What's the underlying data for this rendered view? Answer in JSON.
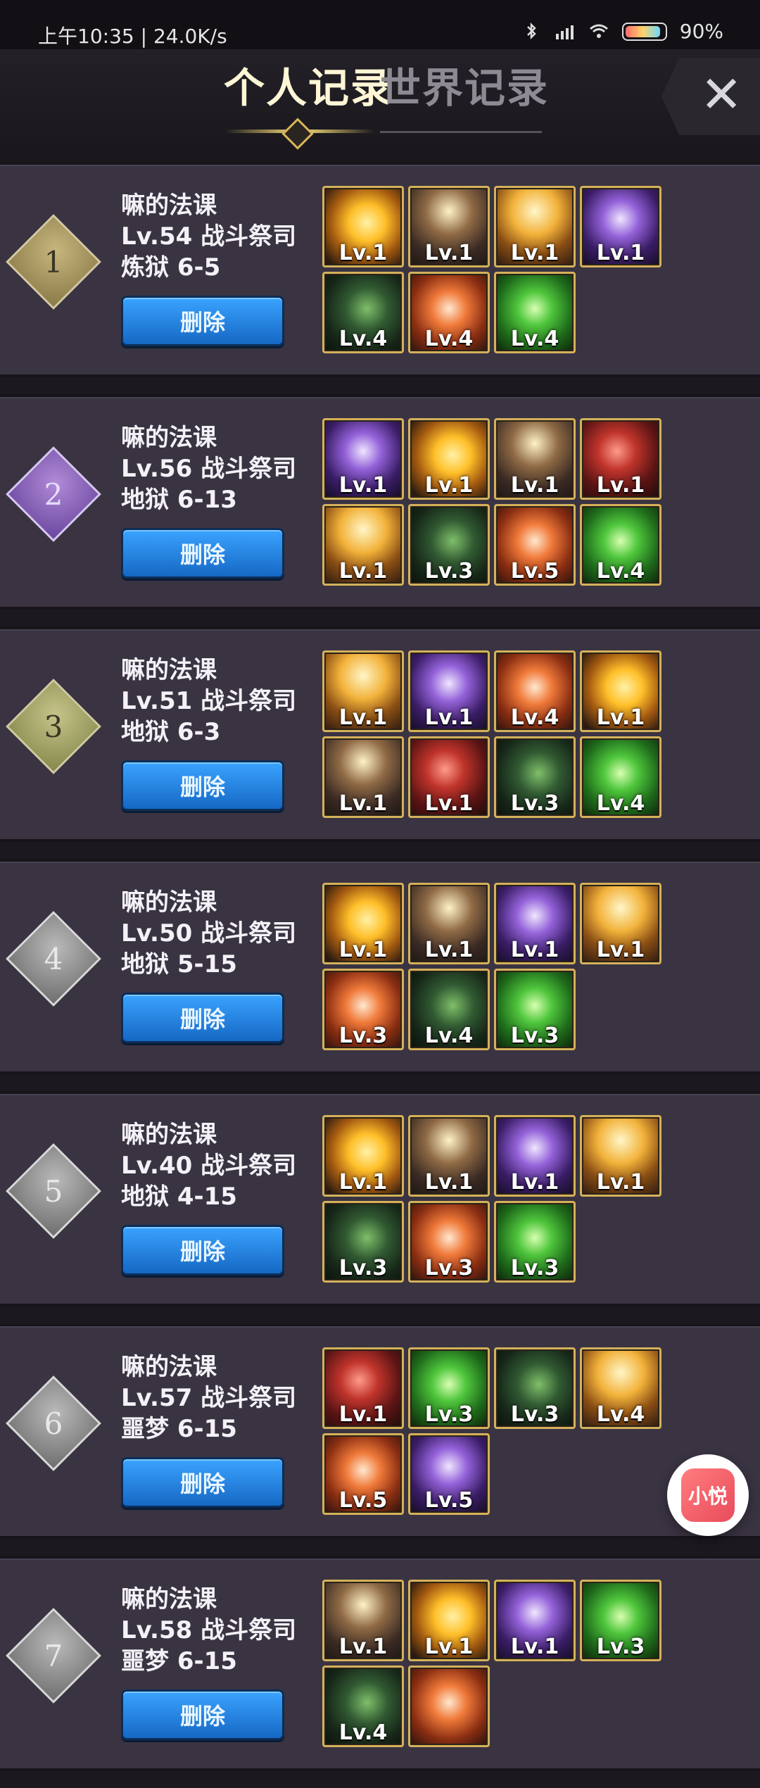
{
  "status": {
    "time": "上午10:35",
    "net_speed": "24.0K/s",
    "battery": "90%",
    "battery_fraction": 0.9
  },
  "header": {
    "tab_personal": "个人记录",
    "tab_world": "世界记录",
    "close_symbol": "✕"
  },
  "records": [
    {
      "rank": "1",
      "rank_style": "r1",
      "name": "嘛的法课",
      "level_class": "Lv.54 战斗祭司",
      "stage": "炼狱 6-5",
      "delete_label": "删除",
      "skills": [
        {
          "tile": "sun",
          "label": "Lv.1"
        },
        {
          "tile": "bow",
          "label": "Lv.1"
        },
        {
          "tile": "angel",
          "label": "Lv.1"
        },
        {
          "tile": "purple",
          "label": "Lv.1"
        },
        {
          "tile": "vines",
          "label": "Lv.4"
        },
        {
          "tile": "shield",
          "label": "Lv.4"
        },
        {
          "tile": "green",
          "label": "Lv.4"
        }
      ]
    },
    {
      "rank": "2",
      "rank_style": "r2",
      "name": "嘛的法课",
      "level_class": "Lv.56 战斗祭司",
      "stage": "地狱 6-13",
      "delete_label": "删除",
      "skills": [
        {
          "tile": "purple",
          "label": "Lv.1"
        },
        {
          "tile": "sun",
          "label": "Lv.1"
        },
        {
          "tile": "bow",
          "label": "Lv.1"
        },
        {
          "tile": "red",
          "label": "Lv.1"
        },
        {
          "tile": "angel",
          "label": "Lv.1"
        },
        {
          "tile": "vines",
          "label": "Lv.3"
        },
        {
          "tile": "shield",
          "label": "Lv.5"
        },
        {
          "tile": "green",
          "label": "Lv.4"
        }
      ]
    },
    {
      "rank": "3",
      "rank_style": "r3",
      "name": "嘛的法课",
      "level_class": "Lv.51 战斗祭司",
      "stage": "地狱 6-3",
      "delete_label": "删除",
      "skills": [
        {
          "tile": "angel",
          "label": "Lv.1"
        },
        {
          "tile": "purple",
          "label": "Lv.1"
        },
        {
          "tile": "shield",
          "label": "Lv.4"
        },
        {
          "tile": "sun",
          "label": "Lv.1"
        },
        {
          "tile": "bow",
          "label": "Lv.1"
        },
        {
          "tile": "red",
          "label": "Lv.1"
        },
        {
          "tile": "vines",
          "label": "Lv.3"
        },
        {
          "tile": "green",
          "label": "Lv.4"
        }
      ]
    },
    {
      "rank": "4",
      "rank_style": "rx",
      "name": "嘛的法课",
      "level_class": "Lv.50 战斗祭司",
      "stage": "地狱 5-15",
      "delete_label": "删除",
      "skills": [
        {
          "tile": "sun",
          "label": "Lv.1"
        },
        {
          "tile": "bow",
          "label": "Lv.1"
        },
        {
          "tile": "purple",
          "label": "Lv.1"
        },
        {
          "tile": "angel",
          "label": "Lv.1"
        },
        {
          "tile": "shield",
          "label": "Lv.3"
        },
        {
          "tile": "vines",
          "label": "Lv.4"
        },
        {
          "tile": "green",
          "label": "Lv.3"
        }
      ]
    },
    {
      "rank": "5",
      "rank_style": "rx",
      "name": "嘛的法课",
      "level_class": "Lv.40 战斗祭司",
      "stage": "地狱 4-15",
      "delete_label": "删除",
      "skills": [
        {
          "tile": "sun",
          "label": "Lv.1"
        },
        {
          "tile": "bow",
          "label": "Lv.1"
        },
        {
          "tile": "purple",
          "label": "Lv.1"
        },
        {
          "tile": "angel",
          "label": "Lv.1"
        },
        {
          "tile": "vines",
          "label": "Lv.3"
        },
        {
          "tile": "shield",
          "label": "Lv.3"
        },
        {
          "tile": "green",
          "label": "Lv.3"
        }
      ]
    },
    {
      "rank": "6",
      "rank_style": "rx",
      "name": "嘛的法课",
      "level_class": "Lv.57 战斗祭司",
      "stage": "噩梦 6-15",
      "delete_label": "删除",
      "skills": [
        {
          "tile": "red",
          "label": "Lv.1"
        },
        {
          "tile": "green",
          "label": "Lv.3"
        },
        {
          "tile": "vines",
          "label": "Lv.3"
        },
        {
          "tile": "angel",
          "label": "Lv.4"
        },
        {
          "tile": "shield",
          "label": "Lv.5"
        },
        {
          "tile": "purple",
          "label": "Lv.5"
        }
      ]
    },
    {
      "rank": "7",
      "rank_style": "rx",
      "name": "嘛的法课",
      "level_class": "Lv.58 战斗祭司",
      "stage": "噩梦 6-15",
      "delete_label": "删除",
      "skills": [
        {
          "tile": "bow",
          "label": "Lv.1"
        },
        {
          "tile": "sun",
          "label": "Lv.1"
        },
        {
          "tile": "purple",
          "label": "Lv.1"
        },
        {
          "tile": "green",
          "label": "Lv.3"
        },
        {
          "tile": "vines",
          "label": "Lv.4"
        },
        {
          "tile": "shield",
          "label": ""
        }
      ]
    }
  ],
  "floating_button": {
    "label": "小悦"
  }
}
